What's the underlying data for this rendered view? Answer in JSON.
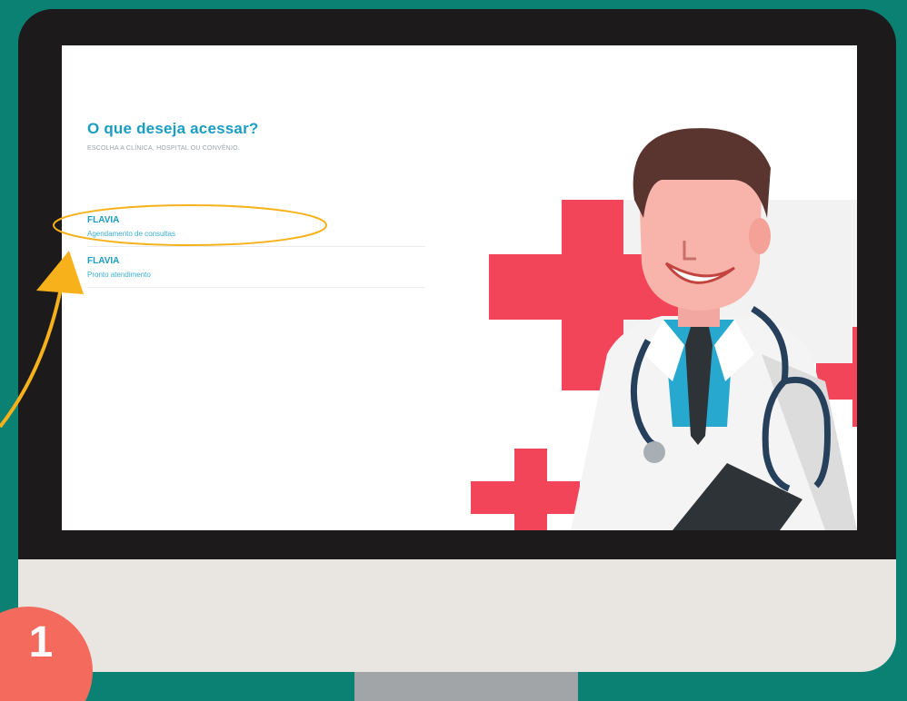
{
  "screen": {
    "title": "O que deseja acessar?",
    "subtitle": "ESCOLHA A CLÍNICA, HOSPITAL OU CONVÊNIO."
  },
  "options": [
    {
      "name": "FLAVIA",
      "description": "Agendamento de consultas"
    },
    {
      "name": "FLAVIA",
      "description": "Pronto atendimento"
    }
  ],
  "step": {
    "number": "1"
  },
  "colors": {
    "background": "#0b8174",
    "accent_blue": "#1a9dc1",
    "highlight": "#f7b21b",
    "cross_red": "#f2455a",
    "badge": "#f46b5d"
  },
  "icons": {
    "illustration": "doctor-with-stethoscope",
    "annotation": "curved-arrow"
  }
}
